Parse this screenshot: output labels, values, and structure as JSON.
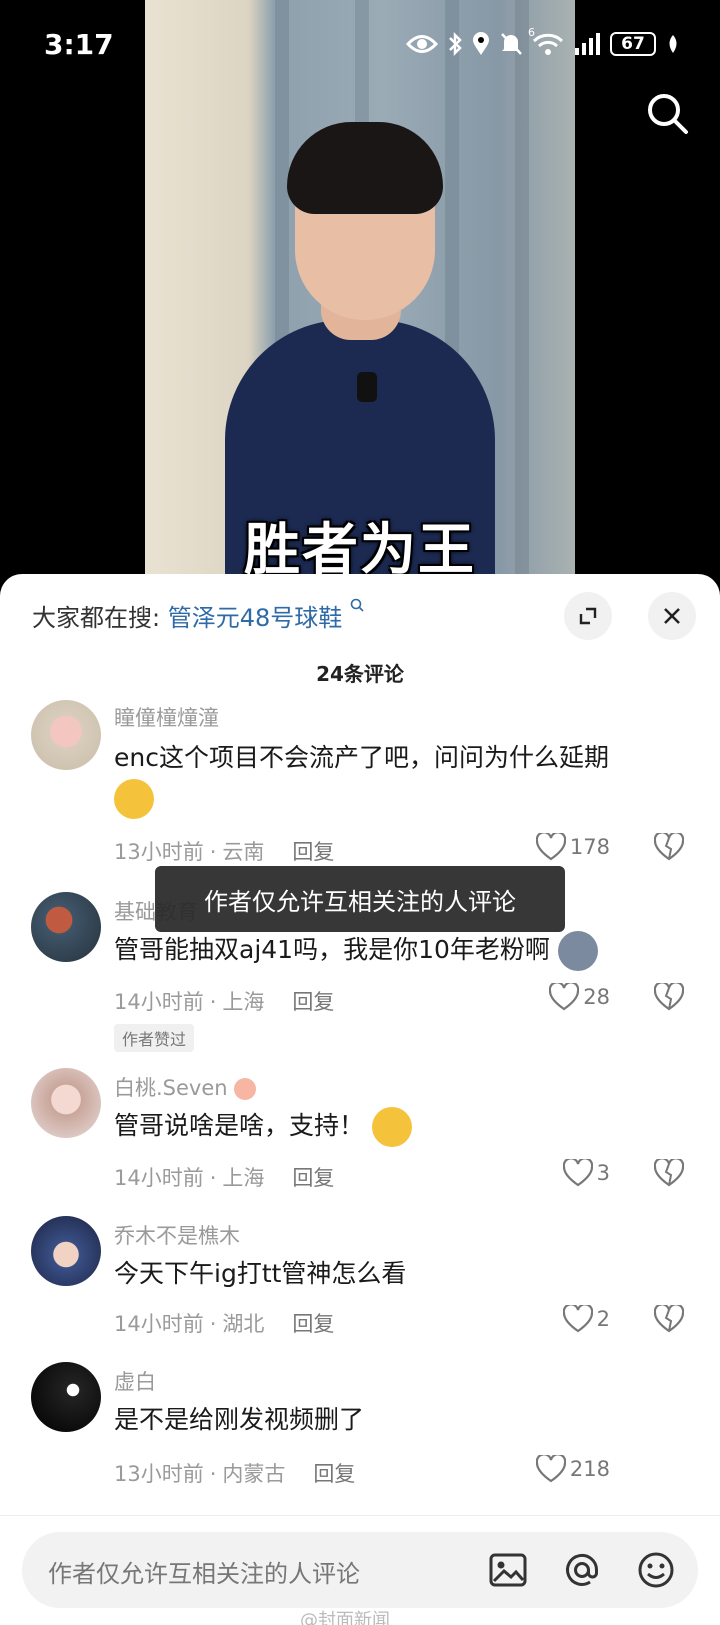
{
  "status_bar": {
    "time": "3:17",
    "battery": "67",
    "network": "6"
  },
  "video": {
    "subtitle": "胜者为王"
  },
  "sheet": {
    "hot_search_prefix": "大家都在搜:",
    "hot_search_term": "管泽元48号球鞋",
    "comment_count": "24条评论",
    "toast": "作者仅允许互相关注的人评论",
    "comments": [
      {
        "user": "瞳僮橦燑潼",
        "text": "enc这个项目不会流产了吧，问问为什么延期",
        "time": "13小时前",
        "location": "云南",
        "reply": "回复",
        "likes": "178"
      },
      {
        "user": "基础教育",
        "text": "管哥能抽双aj41吗，我是你10年老粉啊",
        "time": "14小时前",
        "location": "上海",
        "reply": "回复",
        "likes": "28",
        "badge": "作者赞过"
      },
      {
        "user": "白桃.Seven",
        "text": "管哥说啥是啥，支持！",
        "time": "14小时前",
        "location": "上海",
        "reply": "回复",
        "likes": "3"
      },
      {
        "user": "乔木不是樵木",
        "text": "今天下午ig打tt管神怎么看",
        "time": "14小时前",
        "location": "湖北",
        "reply": "回复",
        "likes": "2"
      },
      {
        "user": "虚白",
        "text": "是不是给刚发视频删了",
        "time": "13小时前",
        "location": "内蒙古",
        "reply": "回复",
        "likes": "218"
      }
    ]
  },
  "input": {
    "placeholder": "作者仅允许互相关注的人评论"
  },
  "watermark": "@封面新闻",
  "colors": {
    "link": "#2e6aa8",
    "meta": "#9a9a9a",
    "sheet": "#ffffff"
  }
}
